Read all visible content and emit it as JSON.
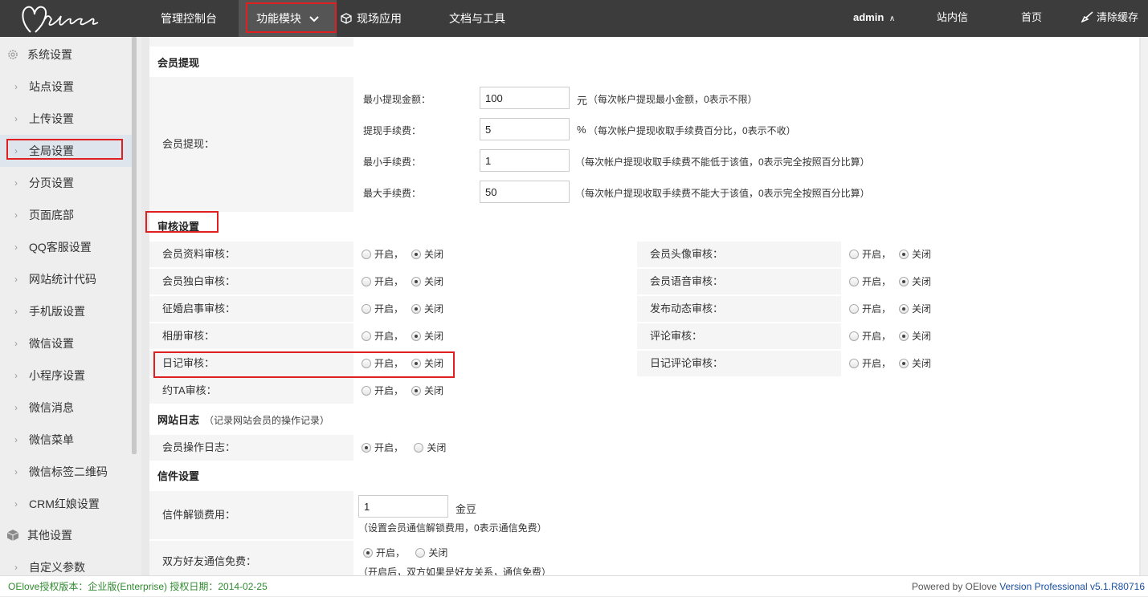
{
  "nav": {
    "items": [
      "管理控制台",
      "功能模块",
      "现场应用",
      "文档与工具"
    ],
    "user": "admin",
    "messages": "站内信",
    "home": "首页",
    "clear_cache": "清除缓存"
  },
  "sidebar": {
    "group1": "系统设置",
    "items": [
      "站点设置",
      "上传设置",
      "全局设置",
      "分页设置",
      "页面底部",
      "QQ客服设置",
      "网站统计代码",
      "手机版设置",
      "微信设置",
      "小程序设置",
      "微信消息",
      "微信菜单",
      "微信标签二维码",
      "CRM红娘设置"
    ],
    "group2": "其他设置",
    "items2": [
      "自定义参数"
    ]
  },
  "withdraw": {
    "title": "会员提现",
    "label": "会员提现：",
    "fields": [
      {
        "label": "最小提现金额：",
        "value": "100",
        "unit": "元",
        "hint": "（每次帐户提现最小金额，0表示不限）"
      },
      {
        "label": "提现手续费：",
        "value": "5",
        "unit": "%",
        "hint": "（每次帐户提现收取手续费百分比，0表示不收）"
      },
      {
        "label": "最小手续费：",
        "value": "1",
        "unit": "",
        "hint": "（每次帐户提现收取手续费不能低于该值，0表示完全按照百分比算）"
      },
      {
        "label": "最大手续费：",
        "value": "50",
        "unit": "",
        "hint": "（每次帐户提现收取手续费不能大于该值，0表示完全按照百分比算）"
      }
    ]
  },
  "audit": {
    "title": "审核设置",
    "on": "开启，",
    "off": "关闭",
    "left": [
      "会员资料审核：",
      "会员独白审核：",
      "征婚启事审核：",
      "相册审核：",
      "日记审核：",
      "约TA审核："
    ],
    "right": [
      "会员头像审核：",
      "会员语音审核：",
      "发布动态审核：",
      "评论审核：",
      "日记评论审核："
    ]
  },
  "site_log": {
    "title": "网站日志",
    "note": "（记录网站会员的操作记录）",
    "label": "会员操作日志：",
    "on": "开启，",
    "off": "关闭"
  },
  "mail": {
    "title": "信件设置",
    "unlock_label": "信件解锁费用：",
    "unlock_value": "1",
    "unlock_unit": "金豆",
    "unlock_hint": "（设置会员通信解锁费用，0表示通信免费）",
    "friend_label": "双方好友通信免费：",
    "on": "开启，",
    "off": "关闭",
    "friend_hint": "（开启后，双方如果是好友关系，通信免费）"
  },
  "footer": {
    "license": "OElove授权版本：企业版(Enterprise) 授权日期：2014-02-25",
    "powered": "Powered by OElove ",
    "version": "Version Professional v5.1.R80716"
  },
  "colors": {
    "topbar": "#3c3c3c",
    "highlight": "#e02020",
    "footer_green": "#2f8a2f",
    "version_blue": "#1a4fa0"
  }
}
